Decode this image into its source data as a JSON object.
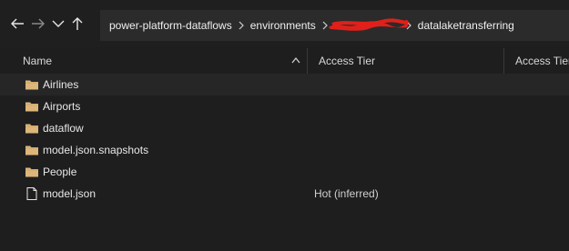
{
  "nav": {
    "back_icon": "arrow-left-icon",
    "forward_icon": "arrow-right-icon",
    "history_icon": "chevron-down-icon",
    "up_icon": "arrow-up-icon"
  },
  "breadcrumb": {
    "items": [
      "power-platform-dataflows",
      "environments",
      "datalaketransferring"
    ],
    "redacted_color": "#e0201a"
  },
  "columns": {
    "name": "Name",
    "access_tier_1": "Access Tier",
    "access_tier_2": "Access Tier"
  },
  "files": [
    {
      "name": "Airlines",
      "type": "folder",
      "tier": ""
    },
    {
      "name": "Airports",
      "type": "folder",
      "tier": ""
    },
    {
      "name": "dataflow",
      "type": "folder",
      "tier": ""
    },
    {
      "name": "model.json.snapshots",
      "type": "folder",
      "tier": ""
    },
    {
      "name": "People",
      "type": "folder",
      "tier": ""
    },
    {
      "name": "model.json",
      "type": "file",
      "tier": "Hot (inferred)"
    }
  ],
  "colors": {
    "background": "#1e1e1e",
    "address_bar": "#2b2b2b",
    "folder": "#dcb67a",
    "selected_row": "#262626"
  }
}
